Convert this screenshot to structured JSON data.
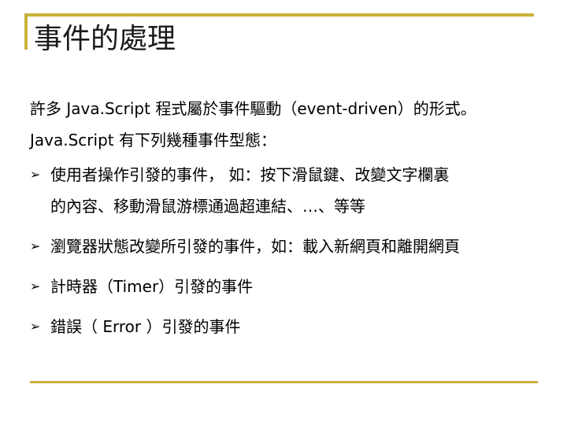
{
  "slide": {
    "title": "事件的處理",
    "intro_lines": [
      "許多 Java.Script 程式屬於事件驅動（event-driven）的形式。",
      "Java.Script 有下列幾種事件型態："
    ],
    "bullets": [
      {
        "lines": [
          "使用者操作引發的事件， 如：按下滑鼠鍵、改變文字欄裏",
          "的內容、移動滑鼠游標通過超連結、…、等等"
        ]
      },
      {
        "lines": [
          "瀏覽器狀態改變所引發的事件，如：載入新網頁和離開網頁"
        ]
      },
      {
        "lines": [
          "計時器（Timer）引發的事件"
        ]
      },
      {
        "lines": [
          "錯誤（ Error ）引發的事件"
        ]
      }
    ],
    "bullet_icon": "arrow-bullet-icon",
    "accent_color": "#c8b23a"
  }
}
